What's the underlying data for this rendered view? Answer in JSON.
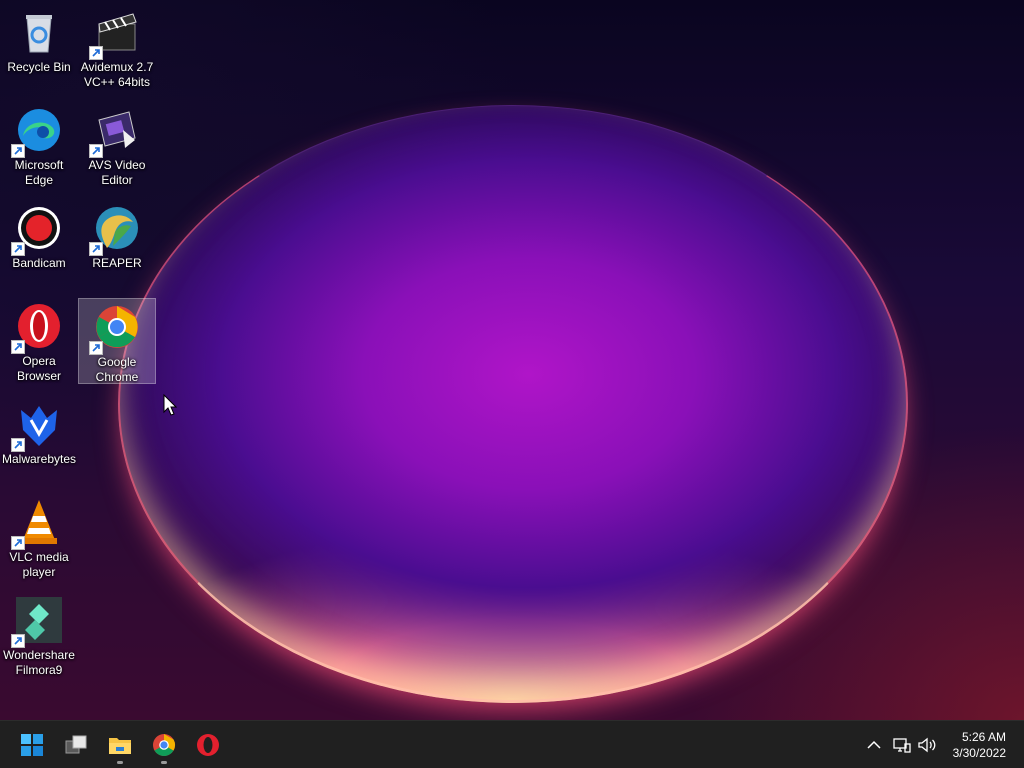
{
  "desktop": {
    "icons": [
      {
        "label": "Recycle Bin",
        "icon": "recycle-bin-icon"
      },
      {
        "label": "Avidemux 2.7 VC++ 64bits",
        "icon": "avidemux-icon"
      },
      {
        "label": "Microsoft Edge",
        "icon": "edge-icon"
      },
      {
        "label": "AVS Video Editor",
        "icon": "avs-video-editor-icon"
      },
      {
        "label": "Bandicam",
        "icon": "bandicam-icon"
      },
      {
        "label": "REAPER",
        "icon": "reaper-icon"
      },
      {
        "label": "Opera Browser",
        "icon": "opera-icon"
      },
      {
        "label": "Google Chrome",
        "icon": "chrome-icon",
        "selected": true
      },
      {
        "label": "Malwarebytes",
        "icon": "malwarebytes-icon"
      },
      {
        "label": "VLC media player",
        "icon": "vlc-icon"
      },
      {
        "label": "Wondershare Filmora9",
        "icon": "filmora-icon"
      }
    ]
  },
  "taskbar": {
    "apps": [
      "start-icon",
      "task-view-icon",
      "file-explorer-icon",
      "chrome-icon",
      "opera-icon"
    ],
    "tray": [
      "show-hidden-icons-chevron-icon",
      "network-icon",
      "volume-icon"
    ],
    "clock": {
      "time": "5:26 AM",
      "date": "3/30/2022"
    }
  },
  "colors": {
    "taskbar": "#202020",
    "selection": "#ffffff38"
  }
}
